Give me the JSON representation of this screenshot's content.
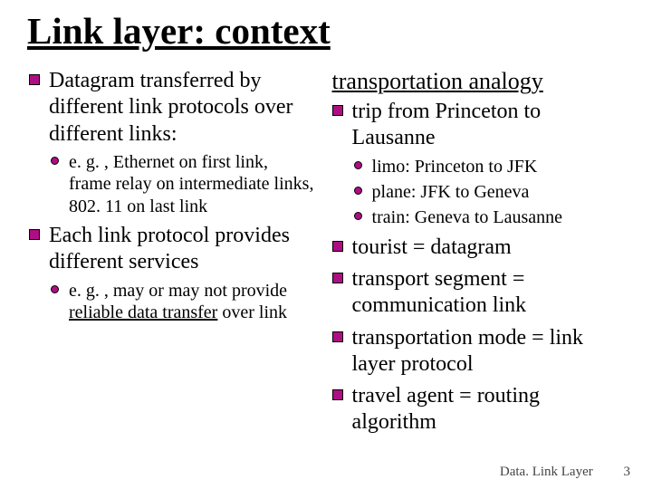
{
  "title": "Link layer: context",
  "left": {
    "b1": {
      "text": "Datagram transferred by different link protocols over different links:",
      "sub1": "e. g. , Ethernet on first link, frame relay on intermediate links, 802. 11 on last link"
    },
    "b2": {
      "text": "Each  link protocol provides different services",
      "sub1_prefix": "e. g. , may or may not provide ",
      "sub1_u": "reliable data transfer",
      "sub1_suffix": " over link"
    }
  },
  "right": {
    "heading": "transportation analogy",
    "b1": {
      "text": "trip from Princeton to Lausanne",
      "s1": "limo: Princeton to JFK",
      "s2": "plane: JFK to Geneva",
      "s3": "train: Geneva to Lausanne"
    },
    "b2": "tourist = datagram",
    "b3": "transport segment = communication link",
    "b4": "transportation mode = link layer protocol",
    "b5": "travel agent = routing algorithm"
  },
  "footer": {
    "label": "Data. Link Layer",
    "page": "3"
  }
}
